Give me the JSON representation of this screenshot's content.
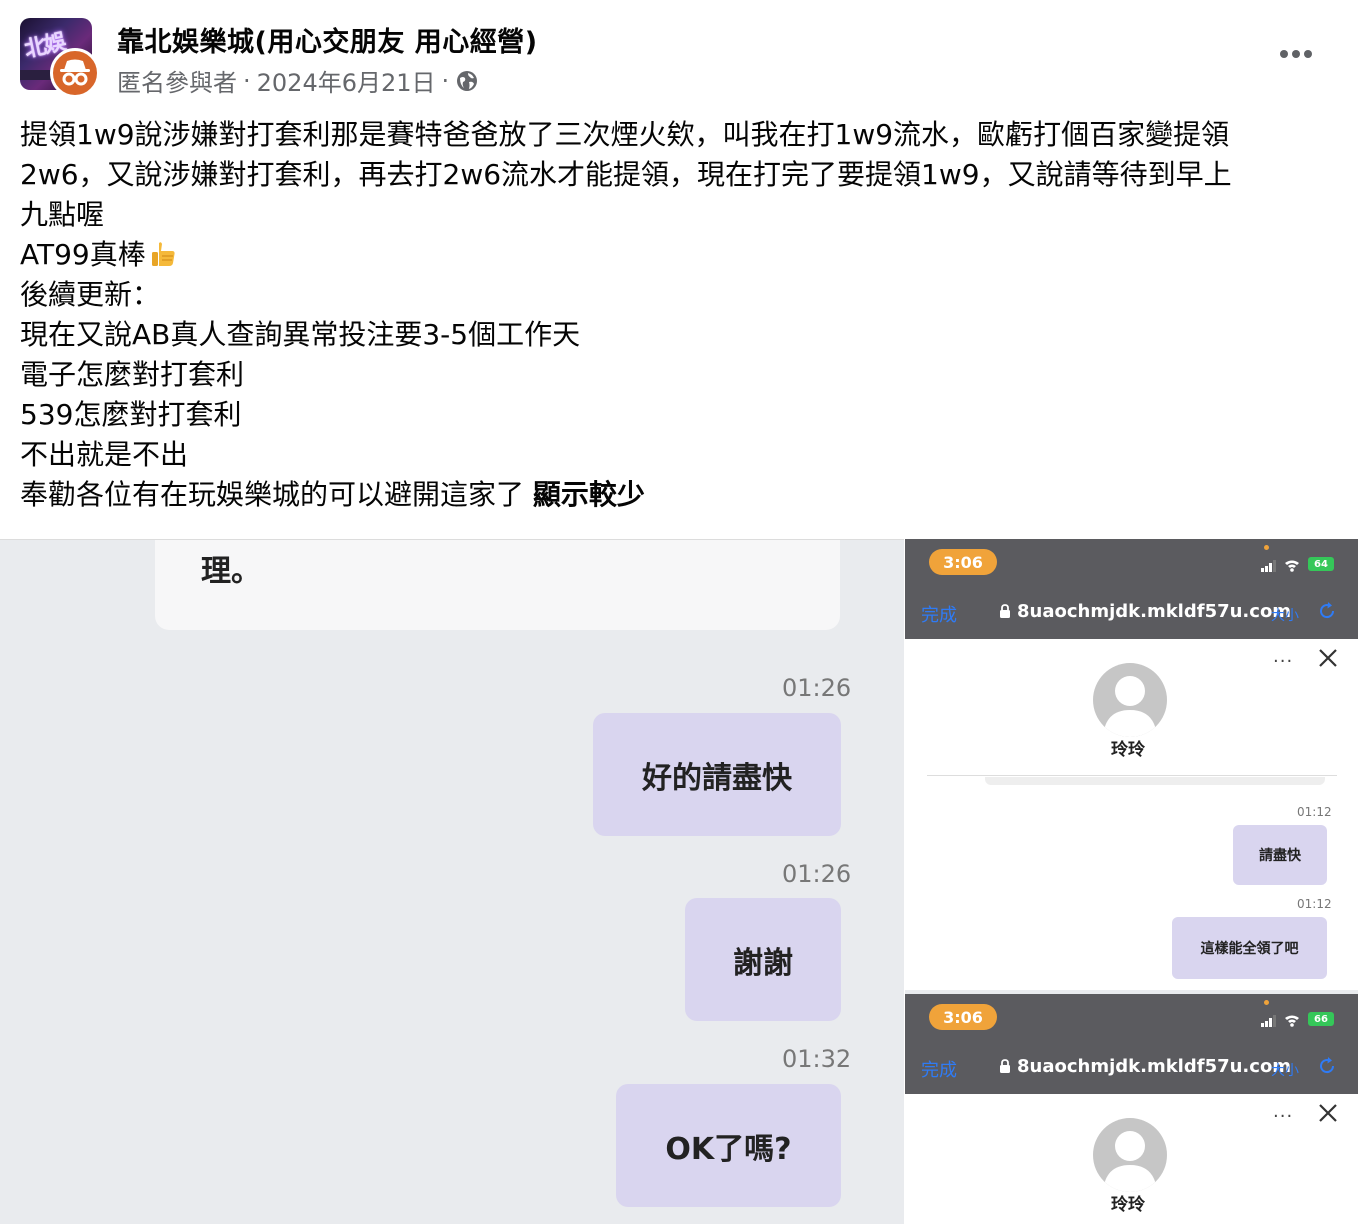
{
  "header": {
    "group_name": "靠北娛樂城(用心交朋友 用心經營)",
    "author": "匿名參與者",
    "separator": "·",
    "date": "2024年6月21日",
    "group_thumb_text": "北娛",
    "icons": {
      "anon": "anonymous-icon",
      "privacy": "globe-icon",
      "more": "more-horizontal-icon"
    }
  },
  "post": {
    "lines": [
      "提領1w9說涉嫌對打套利那是賽特爸爸放了三次煙火欸，叫我在打1w9流水，歐虧打個百家變提領",
      "2w6，又說涉嫌對打套利，再去打2w6流水才能提領，現在打完了要提領1w9，又說請等待到早上",
      "九點喔",
      "AT99真棒",
      "後續更新：",
      "現在又說AB真人查詢異常投注要3-5個工作天",
      "電子怎麼對打套利",
      "539怎麼對打套利",
      "不出就是不出",
      "奉勸各位有在玩娛樂城的可以避開這家了"
    ],
    "show_less": "顯示較少"
  },
  "image_left": {
    "top_bubble": "理。",
    "messages": [
      {
        "time": "01:26",
        "text": "好的請盡快"
      },
      {
        "time": "01:26",
        "text": "謝謝"
      },
      {
        "time": "01:32",
        "text": "OK了嗎?"
      }
    ]
  },
  "image_right": {
    "phones": [
      {
        "time": "3:06",
        "battery": "64",
        "done": "完成",
        "url": "8uaochmjdk.mkldf57u.com",
        "size": "大小",
        "more": "···",
        "contact": "玲玲",
        "messages": [
          {
            "time": "01:12",
            "text": "請盡快"
          },
          {
            "time": "01:12",
            "text": "這樣能全領了吧"
          }
        ]
      },
      {
        "time": "3:06",
        "battery": "66",
        "done": "完成",
        "url": "8uaochmjdk.mkldf57u.com",
        "size": "大小",
        "more": "···",
        "contact": "玲玲"
      }
    ]
  },
  "colors": {
    "bubble": "#d9d5ef",
    "accent_blue": "#2f7bf5",
    "status_orange": "#f0a33a",
    "anon_badge": "#d8662a"
  }
}
